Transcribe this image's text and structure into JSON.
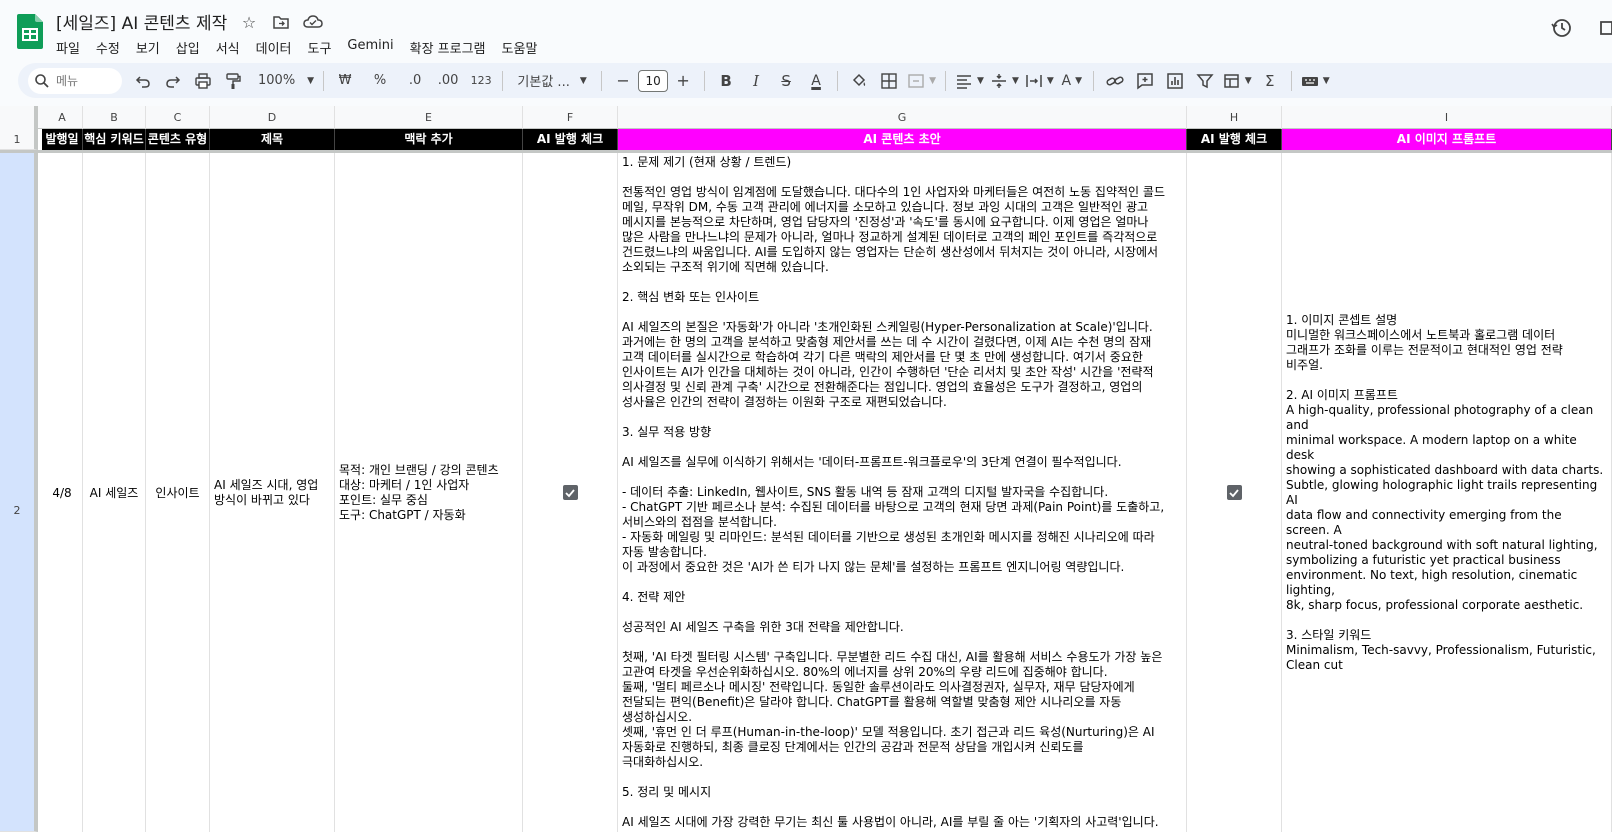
{
  "document": {
    "title": "[세일즈] AI 콘텐츠 제작"
  },
  "menu": [
    "파일",
    "수정",
    "보기",
    "삽입",
    "서식",
    "데이터",
    "도구",
    "Gemini",
    "확장 프로그램",
    "도움말"
  ],
  "toolbar": {
    "search_placeholder": "메뉴",
    "zoom": "100%",
    "currency": "₩",
    "percent": "%",
    "decimal_decrease": ".0",
    "decimal_increase": ".00",
    "number_format": "123",
    "font": "기본값 ...",
    "font_size": "10",
    "minus": "−",
    "plus": "+"
  },
  "columns": [
    "A",
    "B",
    "C",
    "D",
    "E",
    "F",
    "G",
    "H",
    "I"
  ],
  "rows": [
    "1",
    "2"
  ],
  "headers": {
    "a": "발행일",
    "b": "핵심 키워드",
    "c": "콘텐츠 유형",
    "d": "제목",
    "e": "맥락 추가",
    "f": "AI 발행 체크",
    "g": "AI 콘텐츠 초안",
    "h": "AI 발행 체크",
    "i": "AI 이미지 프롬프트"
  },
  "header_colors": {
    "black": "#000000",
    "magenta": "#ff00ff",
    "selected_row": "#d3e3fd"
  },
  "row2": {
    "a": "4/8",
    "b": "AI 세일즈",
    "c": "인사이트",
    "d": "AI 세일즈 시대, 영업 방식이 바뀌고 있다",
    "e": "목적: 개인 브랜딩 / 강의 콘텐츠\n대상: 마케터 / 1인 사업자\n포인트: 실무 중심\n도구: ChatGPT / 자동화",
    "f_checked": true,
    "g": "1. 문제 제기 (현재 상황 / 트렌드)\n\n전통적인 영업 방식이 임계점에 도달했습니다. 대다수의 1인 사업자와 마케터들은 여전히 노동 집약적인 콜드\n메일, 무작위 DM, 수동 고객 관리에 에너지를 소모하고 있습니다. 정보 과잉 시대의 고객은 일반적인 광고\n메시지를 본능적으로 차단하며, 영업 담당자의 '진정성'과 '속도'를 동시에 요구합니다. 이제 영업은 얼마나\n많은 사람을 만나느냐의 문제가 아니라, 얼마나 정교하게 설계된 데이터로 고객의 페인 포인트를 즉각적으로\n건드렸느냐의 싸움입니다. AI를 도입하지 않는 영업자는 단순히 생산성에서 뒤처지는 것이 아니라, 시장에서\n소외되는 구조적 위기에 직면해 있습니다.\n\n2. 핵심 변화 또는 인사이트\n\nAI 세일즈의 본질은 '자동화'가 아니라 '초개인화된 스케일링(Hyper-Personalization at Scale)'입니다.\n과거에는 한 명의 고객을 분석하고 맞춤형 제안서를 쓰는 데 수 시간이 걸렸다면, 이제 AI는 수천 명의 잠재\n고객 데이터를 실시간으로 학습하여 각기 다른 맥락의 제안서를 단 몇 초 만에 생성합니다. 여기서 중요한\n인사이트는 AI가 인간을 대체하는 것이 아니라, 인간이 수행하던 '단순 리서치 및 초안 작성' 시간을 '전략적\n의사결정 및 신뢰 관계 구축' 시간으로 전환해준다는 점입니다. 영업의 효율성은 도구가 결정하고, 영업의\n성사율은 인간의 전략이 결정하는 이원화 구조로 재편되었습니다.\n\n3. 실무 적용 방향\n\nAI 세일즈를 실무에 이식하기 위해서는 '데이터-프롬프트-워크플로우'의 3단계 연결이 필수적입니다.\n\n- 데이터 추출: LinkedIn, 웹사이트, SNS 활동 내역 등 잠재 고객의 디지털 발자국을 수집합니다.\n- ChatGPT 기반 페르소나 분석: 수집된 데이터를 바탕으로 고객의 현재 당면 과제(Pain Point)를 도출하고,\n서비스와의 접점을 분석합니다.\n- 자동화 메일링 및 리마인드: 분석된 데이터를 기반으로 생성된 초개인화 메시지를 정해진 시나리오에 따라\n자동 발송합니다.\n이 과정에서 중요한 것은 'AI가 쓴 티가 나지 않는 문체'를 설정하는 프롬프트 엔지니어링 역량입니다.\n\n4. 전략 제안\n\n성공적인 AI 세일즈 구축을 위한 3대 전략을 제안합니다.\n\n첫째, 'AI 타겟 필터링 시스템' 구축입니다. 무분별한 리드 수집 대신, AI를 활용해 서비스 수용도가 가장 높은\n고관여 타겟을 우선순위화하십시오. 80%의 에너지를 상위 20%의 우량 리드에 집중해야 합니다.\n둘째, '멀티 페르소나 메시징' 전략입니다. 동일한 솔루션이라도 의사결정권자, 실무자, 재무 담당자에게\n전달되는 편익(Benefit)은 달라야 합니다. ChatGPT를 활용해 역할별 맞춤형 제안 시나리오를 자동\n생성하십시오.\n셋째, '휴먼 인 더 루프(Human-in-the-loop)' 모델 적용입니다. 초기 접근과 리드 육성(Nurturing)은 AI\n자동화로 진행하되, 최종 클로징 단계에서는 인간의 공감과 전문적 상담을 개입시켜 신뢰도를\n극대화하십시오.\n\n5. 정리 및 메시지\n\nAI 세일즈 시대에 가장 강력한 무기는 최신 툴 사용법이 아니라, AI를 부릴 줄 아는 '기획자의 사고력'입니다.",
    "h_checked": true,
    "i": "1. 이미지 콘셉트 설명\n미니멀한 워크스페이스에서 노트북과 홀로그램 데이터\n그래프가 조화를 이루는 전문적이고 현대적인 영업 전략\n비주얼.\n\n2. AI 이미지 프롬프트\nA high-quality, professional photography of a clean and\nminimal workspace. A modern laptop on a white desk\nshowing a sophisticated dashboard with data charts.\nSubtle, glowing holographic light trails representing AI\ndata flow and connectivity emerging from the screen. A\nneutral-toned background with soft natural lighting,\nsymbolizing a futuristic yet practical business\nenvironment. No text, high resolution, cinematic lighting,\n8k, sharp focus, professional corporate aesthetic.\n\n3. 스타일 키워드\nMinimalism, Tech-savvy, Professionalism, Futuristic,\nClean cut"
  }
}
